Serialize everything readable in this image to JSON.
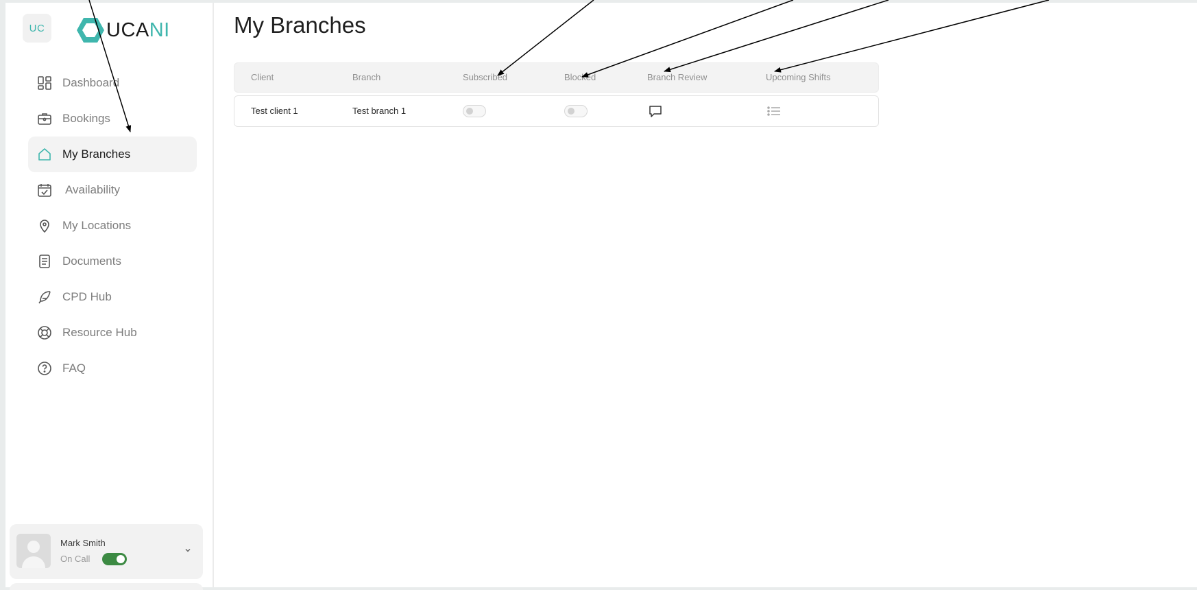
{
  "sidebar": {
    "badge": "UC",
    "logo": {
      "part1": "UCA",
      "part2": "NI"
    },
    "items": [
      {
        "label": "Dashboard",
        "icon": "dashboard-icon",
        "active": false
      },
      {
        "label": "Bookings",
        "icon": "briefcase-icon",
        "active": false
      },
      {
        "label": "My Branches",
        "icon": "home-icon",
        "active": true
      },
      {
        "label": "Availability",
        "icon": "calendar-check-icon",
        "active": false
      },
      {
        "label": "My Locations",
        "icon": "location-pin-icon",
        "active": false
      },
      {
        "label": "Documents",
        "icon": "document-icon",
        "active": false
      },
      {
        "label": "CPD Hub",
        "icon": "feather-icon",
        "active": false
      },
      {
        "label": "Resource Hub",
        "icon": "lifebuoy-icon",
        "active": false
      },
      {
        "label": "FAQ",
        "icon": "question-circle-icon",
        "active": false
      }
    ],
    "profile": {
      "name": "Mark Smith",
      "status": "On Call",
      "on_call": true
    }
  },
  "main": {
    "title": "My Branches",
    "table": {
      "columns": [
        "Client",
        "Branch",
        "Subscribed",
        "Blocked",
        "Branch Review",
        "Upcoming Shifts"
      ],
      "rows": [
        {
          "client": "Test client 1",
          "branch": "Test branch 1",
          "subscribed": false,
          "blocked": false,
          "review_icon": "chat-bubble-icon",
          "shifts_icon": "list-icon"
        }
      ]
    }
  },
  "colors": {
    "accent": "#3fb6ad",
    "toggle_on": "#3c8a43",
    "active_bg": "#f3f3f3"
  }
}
